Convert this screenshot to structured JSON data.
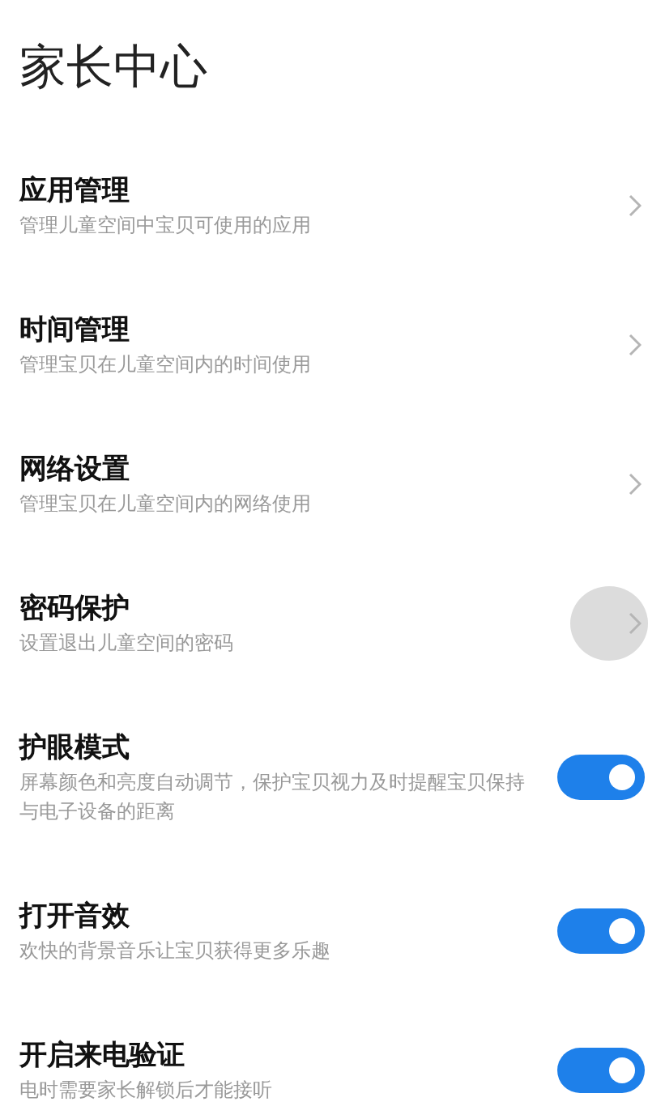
{
  "title": "家长中心",
  "items": [
    {
      "kind": "link",
      "label": "应用管理",
      "description": "管理儿童空间中宝贝可使用的应用",
      "pressed": false
    },
    {
      "kind": "link",
      "label": "时间管理",
      "description": "管理宝贝在儿童空间内的时间使用",
      "pressed": false
    },
    {
      "kind": "link",
      "label": "网络设置",
      "description": "管理宝贝在儿童空间内的网络使用",
      "pressed": false
    },
    {
      "kind": "link",
      "label": "密码保护",
      "description": "设置退出儿童空间的密码",
      "pressed": true
    },
    {
      "kind": "switch",
      "label": "护眼模式",
      "description": "屏幕颜色和亮度自动调节，保护宝贝视力及时提醒宝贝保持与电子设备的距离",
      "on": true
    },
    {
      "kind": "switch",
      "label": "打开音效",
      "description": "欢快的背景音乐让宝贝获得更多乐趣",
      "on": true
    },
    {
      "kind": "switch",
      "label": "开启来电验证",
      "description": "电时需要家长解锁后才能接听",
      "on": true
    }
  ]
}
